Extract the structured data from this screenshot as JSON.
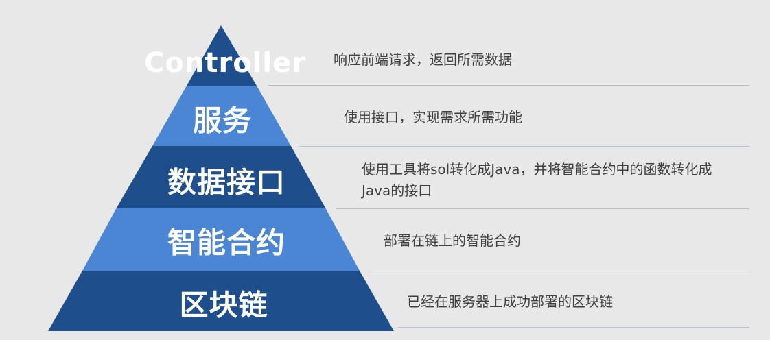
{
  "layers": [
    {
      "label": "Controller",
      "description": "响应前端请求，返回所需数据",
      "color": "#1f4e8c"
    },
    {
      "label": "服务",
      "description": "使用接口，实现需求所需功能",
      "color": "#4a86d4"
    },
    {
      "label": "数据接口",
      "description_lines": [
        "使用工具将sol转化成Java，并将智能合约中的函数转化成",
        "Java的接口"
      ],
      "color": "#1f4e8c"
    },
    {
      "label": "智能合约",
      "description": "部署在链上的智能合约",
      "color": "#4a86d4"
    },
    {
      "label": "区块链",
      "description": "已经在服务器上成功部署的区块链",
      "color": "#1f4e8c"
    }
  ]
}
